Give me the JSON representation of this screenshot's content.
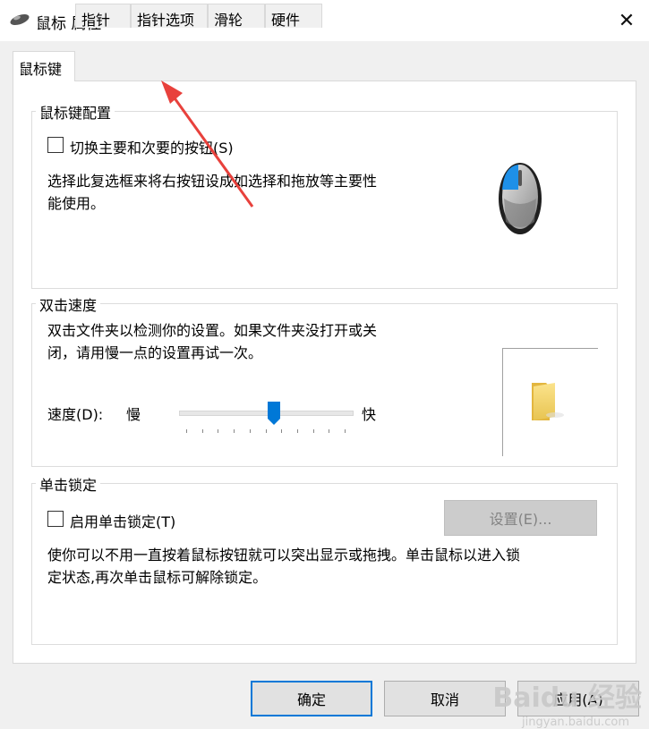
{
  "window": {
    "title": "鼠标 属性",
    "close_glyph": "✕",
    "icon": "mouse-icon"
  },
  "tabs": [
    {
      "label": "鼠标键",
      "active": true
    },
    {
      "label": "指针",
      "active": false
    },
    {
      "label": "指针选项",
      "active": false
    },
    {
      "label": "滑轮",
      "active": false
    },
    {
      "label": "硬件",
      "active": false
    }
  ],
  "button_config": {
    "group_title": "鼠标键配置",
    "checkbox_label": "切换主要和次要的按钮(S)",
    "checked": false,
    "description_line1": "选择此复选框来将右按钮设成如选择和拖放等主要性",
    "description_line2": "能使用。",
    "icon": "mouse-illustration-icon"
  },
  "double_click": {
    "group_title": "双击速度",
    "description_line1": "双击文件夹以检测你的设置。如果文件夹没打开或关",
    "description_line2": "闭，请用慢一点的设置再试一次。",
    "speed_label": "速度(D):",
    "slow_label": "慢",
    "fast_label": "快",
    "speed_value_fraction": 0.55,
    "icon": "folder-icon"
  },
  "click_lock": {
    "group_title": "单击锁定",
    "checkbox_label": "启用单击锁定(T)",
    "checked": false,
    "settings_button": "设置(E)...",
    "description_line1": "使你可以不用一直按着鼠标按钮就可以突出显示或拖拽。单击鼠标以进入锁",
    "description_line2": "定状态,再次单击鼠标可解除锁定。"
  },
  "footer": {
    "ok": "确定",
    "cancel": "取消",
    "apply": "应用(A)"
  },
  "watermark": {
    "text": "Baidu 经验",
    "sub": "jingyan.baidu.com"
  },
  "colors": {
    "accent": "#0078d7",
    "annotation_arrow": "#e8413c"
  }
}
